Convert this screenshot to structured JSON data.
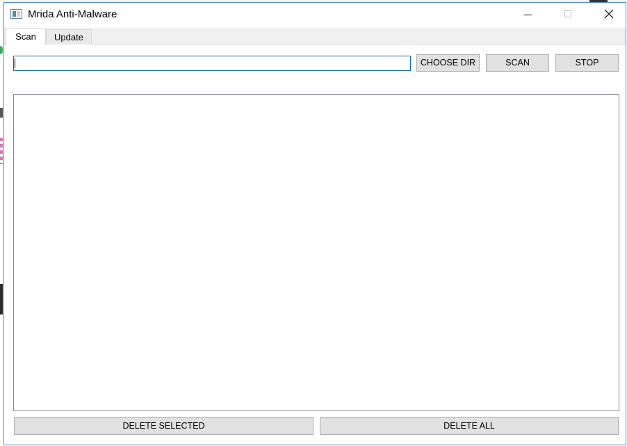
{
  "window": {
    "title": "Mrida Anti-Malware"
  },
  "tabs": [
    {
      "label": "Scan",
      "selected": true
    },
    {
      "label": "Update",
      "selected": false
    }
  ],
  "scan": {
    "path_value": "",
    "buttons": {
      "choose_dir": "CHOOSE DIR",
      "scan": "SCAN",
      "stop": "STOP",
      "delete_selected": "DELETE SELECTED",
      "delete_all": "DELETE ALL"
    },
    "results": []
  },
  "icons": {
    "app": "app-window-icon",
    "minimize": "minimize-icon",
    "maximize": "maximize-icon",
    "close": "close-icon"
  },
  "colors": {
    "window_border": "#4a89c8",
    "input_border": "#0f6f9e",
    "button_bg": "#e1e1e1",
    "tabbar_bg": "#f0f0f0"
  }
}
